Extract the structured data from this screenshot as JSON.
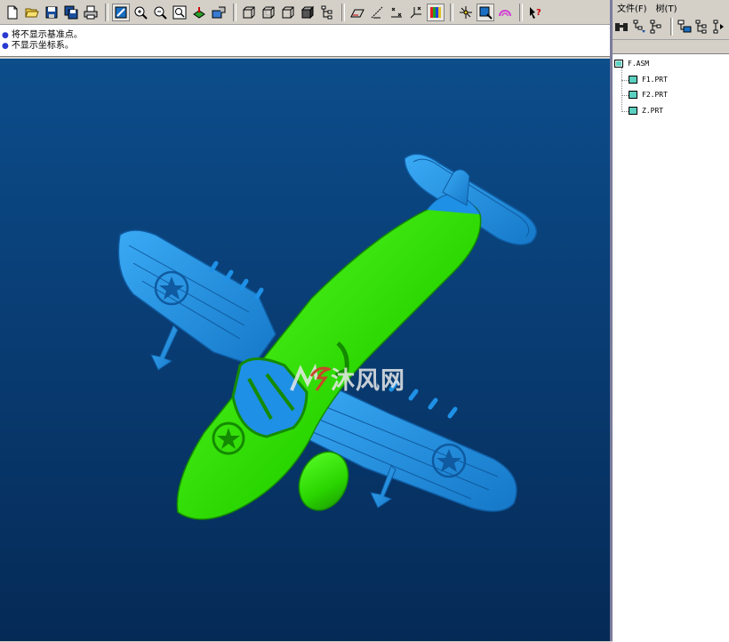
{
  "messages": [
    {
      "text": "将不显示基准点。"
    },
    {
      "text": "不显示坐标系。"
    }
  ],
  "right_panel": {
    "menu": {
      "file": "文件(F)",
      "tree": "树(T)"
    }
  },
  "model_tree": {
    "root": "F.ASM",
    "children": [
      "F1.PRT",
      "F2.PRT",
      "Z.PRT"
    ]
  },
  "watermark": {
    "text": "沐风网"
  },
  "colors": {
    "viewport_top": "#0c4d8b",
    "viewport_bottom": "#052a56",
    "fuselage": "#27d400",
    "wings": "#1e90e6",
    "panel": "#d4d0c8"
  }
}
